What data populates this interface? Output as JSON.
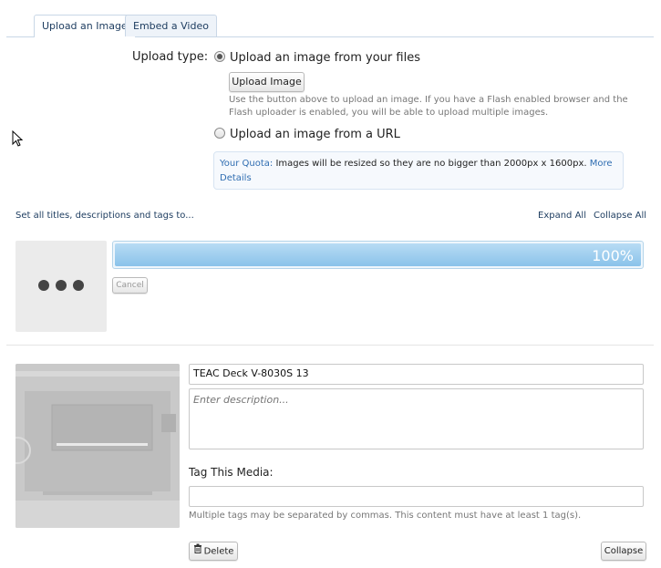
{
  "tabs": [
    {
      "label": "Upload an Image"
    },
    {
      "label": "Embed a Video"
    }
  ],
  "upload_form": {
    "upload_type_label": "Upload type:",
    "option_files": "Upload an image from your files",
    "option_url": "Upload an image from a URL",
    "selected_option": "files",
    "upload_button": "Upload Image",
    "upload_help": "Use the button above to upload an image. If you have a Flash enabled browser and the Flash uploader is enabled, you will be able to upload multiple images.",
    "quota_label": "Your Quota:",
    "quota_text": " Images will be resized so they are no bigger than 2000px x 1600px. ",
    "quota_link": "More Details"
  },
  "actions": {
    "set_all": "Set all titles, descriptions and tags to...",
    "expand_all": "Expand All",
    "collapse_all": "Collapse All"
  },
  "upload_progress": {
    "percent_text": "100%",
    "percent_value": 100,
    "cancel_label": "Cancel"
  },
  "media_item": {
    "title_value": "TEAC Deck V-8030S 13",
    "description_placeholder": "Enter description...",
    "tag_label": "Tag This Media:",
    "tag_value": "",
    "tag_help": "Multiple tags may be separated by commas. This content must have at least 1 tag(s).",
    "delete_label": "Delete",
    "collapse_label": "Collapse"
  },
  "colors": {
    "accent": "#2f6db1",
    "progress_fill": "#8ac3ea"
  }
}
